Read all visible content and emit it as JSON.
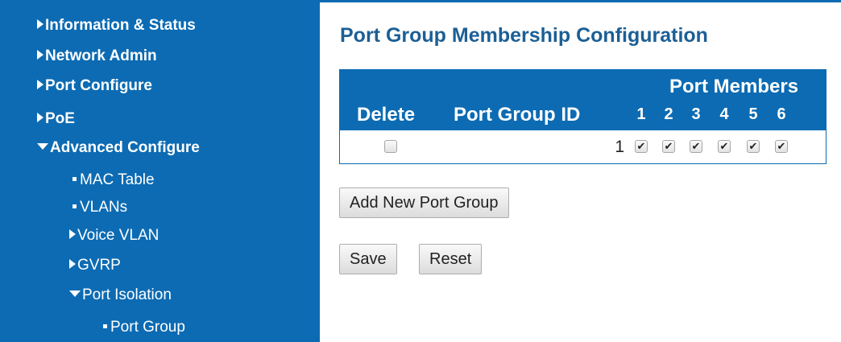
{
  "sidebar": {
    "items": [
      {
        "label": "Information & Status",
        "marker": "arrow-right"
      },
      {
        "label": "Network Admin",
        "marker": "arrow-right"
      },
      {
        "label": "Port Configure",
        "marker": "arrow-right"
      },
      {
        "label": "PoE",
        "marker": "arrow-right"
      },
      {
        "label": "Advanced Configure",
        "marker": "arrow-down"
      },
      {
        "label": "MAC Table",
        "marker": "bullet"
      },
      {
        "label": "VLANs",
        "marker": "bullet"
      },
      {
        "label": "Voice VLAN",
        "marker": "arrow-right"
      },
      {
        "label": "GVRP",
        "marker": "arrow-right"
      },
      {
        "label": "Port Isolation",
        "marker": "arrow-down"
      },
      {
        "label": "Port Group",
        "marker": "bullet"
      }
    ]
  },
  "main": {
    "title": "Port Group Membership Configuration",
    "table": {
      "group_header": "Port Members",
      "col_delete": "Delete",
      "col_group_id": "Port Group ID",
      "ports": [
        "1",
        "2",
        "3",
        "4",
        "5",
        "6"
      ],
      "rows": [
        {
          "delete_checked": false,
          "group_id": "1",
          "members": [
            true,
            true,
            true,
            true,
            true,
            true
          ]
        }
      ]
    },
    "buttons": {
      "add": "Add New Port Group",
      "save": "Save",
      "reset": "Reset"
    }
  },
  "colors": {
    "sidebar_bg": "#0c6bb3",
    "title": "#1c5f95",
    "header_bg": "#0c6bb3"
  }
}
